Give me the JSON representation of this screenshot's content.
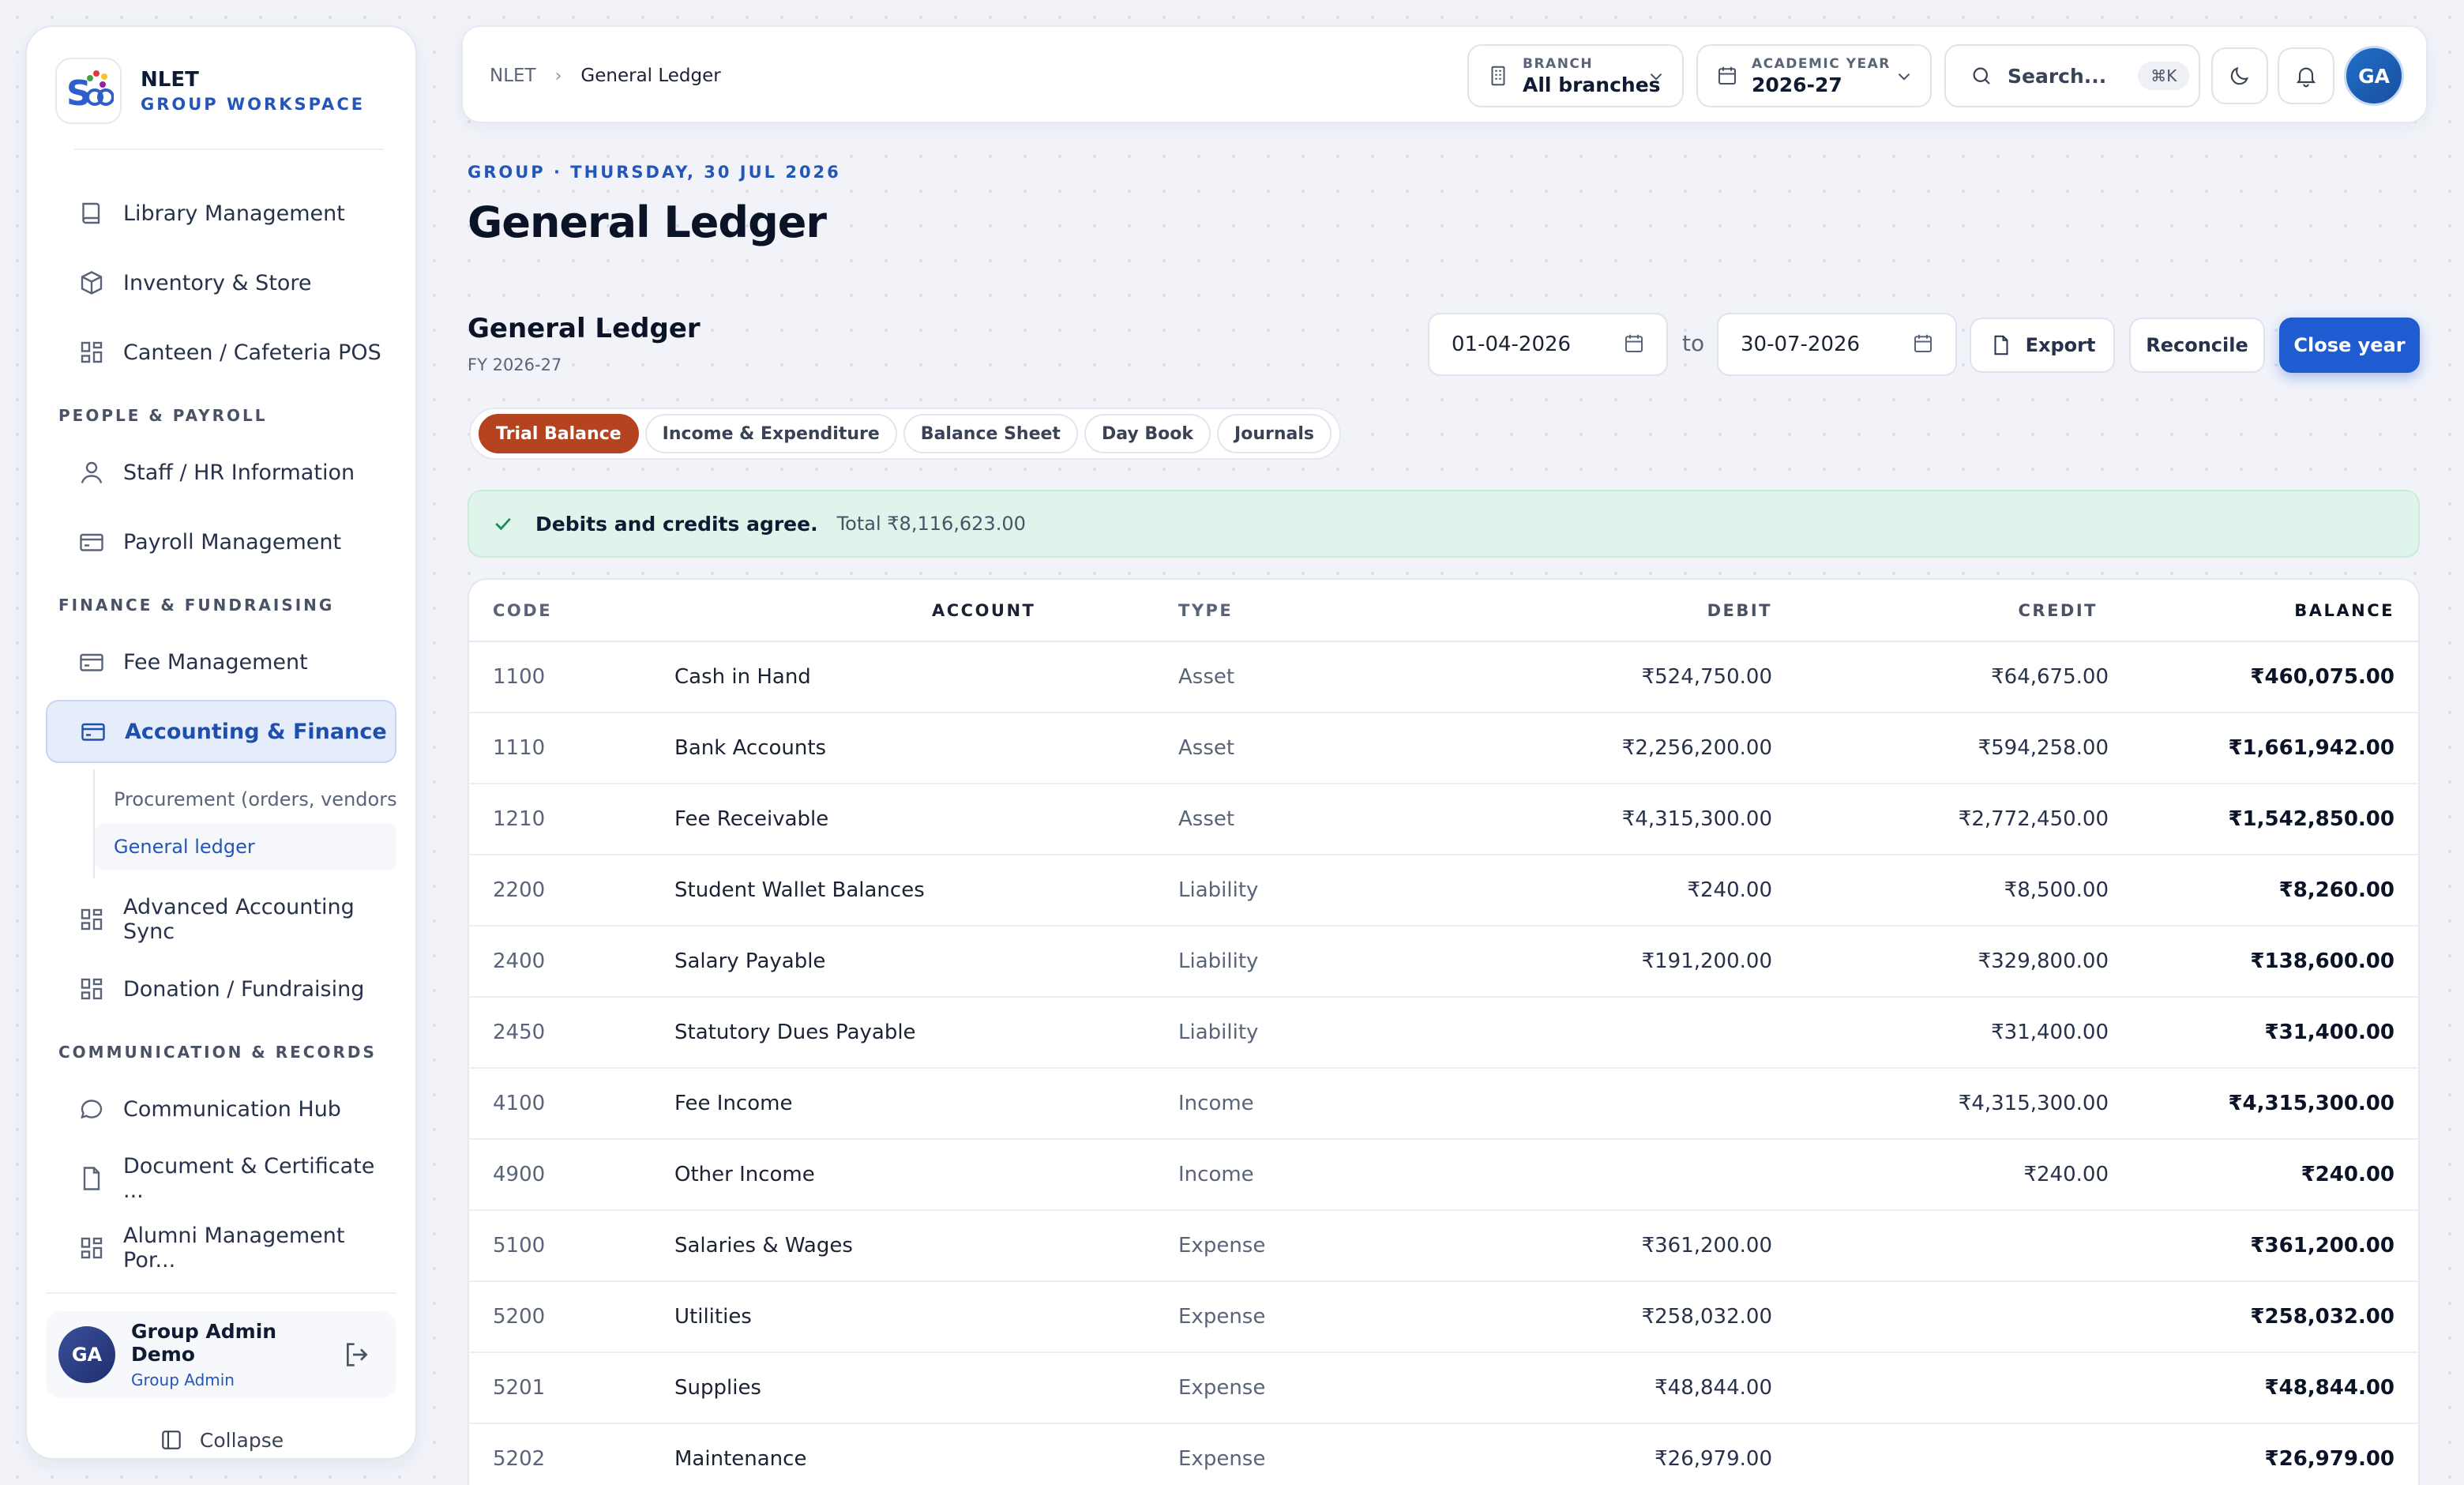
{
  "brand": {
    "logo_text": "S",
    "name": "NLET",
    "sub": "GROUP WORKSPACE"
  },
  "sidebar": {
    "items_top": [
      {
        "label": "Library Management",
        "icon": "book-icon"
      },
      {
        "label": "Inventory & Store",
        "icon": "box-icon"
      },
      {
        "label": "Canteen / Cafeteria POS",
        "icon": "grid-icon"
      }
    ],
    "section_people": "PEOPLE & PAYROLL",
    "items_people": [
      {
        "label": "Staff / HR Information",
        "icon": "user-icon"
      },
      {
        "label": "Payroll Management",
        "icon": "card-icon"
      }
    ],
    "section_finance": "FINANCE & FUNDRAISING",
    "items_finance": [
      {
        "label": "Fee Management",
        "icon": "card-icon"
      },
      {
        "label": "Accounting & Finance",
        "icon": "card-icon",
        "active": true
      }
    ],
    "sub_items": [
      {
        "label": "Procurement (orders, vendors,..."
      },
      {
        "label": "General ledger",
        "active": true
      }
    ],
    "items_finance2": [
      {
        "label": "Advanced Accounting Sync",
        "icon": "grid-icon"
      },
      {
        "label": "Donation / Fundraising",
        "icon": "grid-icon"
      }
    ],
    "section_comm": "COMMUNICATION & RECORDS",
    "items_comm": [
      {
        "label": "Communication Hub",
        "icon": "chat-icon"
      },
      {
        "label": "Document & Certificate ...",
        "icon": "file-icon"
      },
      {
        "label": "Alumni Management Por...",
        "icon": "grid-icon"
      }
    ],
    "user": {
      "initials": "GA",
      "name": "Group Admin Demo",
      "role": "Group Admin"
    },
    "collapse_label": "Collapse"
  },
  "topbar": {
    "breadcrumb_root": "NLET",
    "breadcrumb_sep": "›",
    "breadcrumb_current": "General Ledger",
    "branch_label": "BRANCH",
    "branch_value": "All branches",
    "year_label": "ACADEMIC YEAR",
    "year_value": "2026-27",
    "search_placeholder": "Search...",
    "search_shortcut": "⌘K",
    "avatar_initials": "GA"
  },
  "page": {
    "kicker": "GROUP · THURSDAY, 30 JUL 2026",
    "title": "General Ledger",
    "section_title": "General Ledger",
    "section_sub": "FY 2026-27",
    "date_from": "01-04-2026",
    "date_to_label": "to",
    "date_to": "30-07-2026",
    "export_label": "Export",
    "reconcile_label": "Reconcile",
    "close_year_label": "Close year"
  },
  "tabs": [
    {
      "label": "Trial Balance",
      "active": true
    },
    {
      "label": "Income & Expenditure"
    },
    {
      "label": "Balance Sheet"
    },
    {
      "label": "Day Book"
    },
    {
      "label": "Journals"
    }
  ],
  "alert": {
    "strong": "Debits and credits agree.",
    "total": "Total ₹8,116,623.00"
  },
  "table": {
    "headers": {
      "code": "CODE",
      "account": "ACCOUNT",
      "type": "TYPE",
      "debit": "DEBIT",
      "credit": "CREDIT",
      "balance": "BALANCE"
    },
    "rows": [
      {
        "code": "1100",
        "account": "Cash in Hand",
        "type": "Asset",
        "debit": "₹524,750.00",
        "credit": "₹64,675.00",
        "balance": "₹460,075.00"
      },
      {
        "code": "1110",
        "account": "Bank Accounts",
        "type": "Asset",
        "debit": "₹2,256,200.00",
        "credit": "₹594,258.00",
        "balance": "₹1,661,942.00"
      },
      {
        "code": "1210",
        "account": "Fee Receivable",
        "type": "Asset",
        "debit": "₹4,315,300.00",
        "credit": "₹2,772,450.00",
        "balance": "₹1,542,850.00"
      },
      {
        "code": "2200",
        "account": "Student Wallet Balances",
        "type": "Liability",
        "debit": "₹240.00",
        "credit": "₹8,500.00",
        "balance": "₹8,260.00"
      },
      {
        "code": "2400",
        "account": "Salary Payable",
        "type": "Liability",
        "debit": "₹191,200.00",
        "credit": "₹329,800.00",
        "balance": "₹138,600.00"
      },
      {
        "code": "2450",
        "account": "Statutory Dues Payable",
        "type": "Liability",
        "debit": "",
        "credit": "₹31,400.00",
        "balance": "₹31,400.00"
      },
      {
        "code": "4100",
        "account": "Fee Income",
        "type": "Income",
        "debit": "",
        "credit": "₹4,315,300.00",
        "balance": "₹4,315,300.00"
      },
      {
        "code": "4900",
        "account": "Other Income",
        "type": "Income",
        "debit": "",
        "credit": "₹240.00",
        "balance": "₹240.00"
      },
      {
        "code": "5100",
        "account": "Salaries & Wages",
        "type": "Expense",
        "debit": "₹361,200.00",
        "credit": "",
        "balance": "₹361,200.00"
      },
      {
        "code": "5200",
        "account": "Utilities",
        "type": "Expense",
        "debit": "₹258,032.00",
        "credit": "",
        "balance": "₹258,032.00"
      },
      {
        "code": "5201",
        "account": "Supplies",
        "type": "Expense",
        "debit": "₹48,844.00",
        "credit": "",
        "balance": "₹48,844.00"
      },
      {
        "code": "5202",
        "account": "Maintenance",
        "type": "Expense",
        "debit": "₹26,979.00",
        "credit": "",
        "balance": "₹26,979.00"
      }
    ]
  },
  "colors": {
    "accent": "#1f5cd1",
    "active_tab": "#b6431f",
    "success_bg": "#dff4ea",
    "brand_blue": "#2456b8"
  }
}
